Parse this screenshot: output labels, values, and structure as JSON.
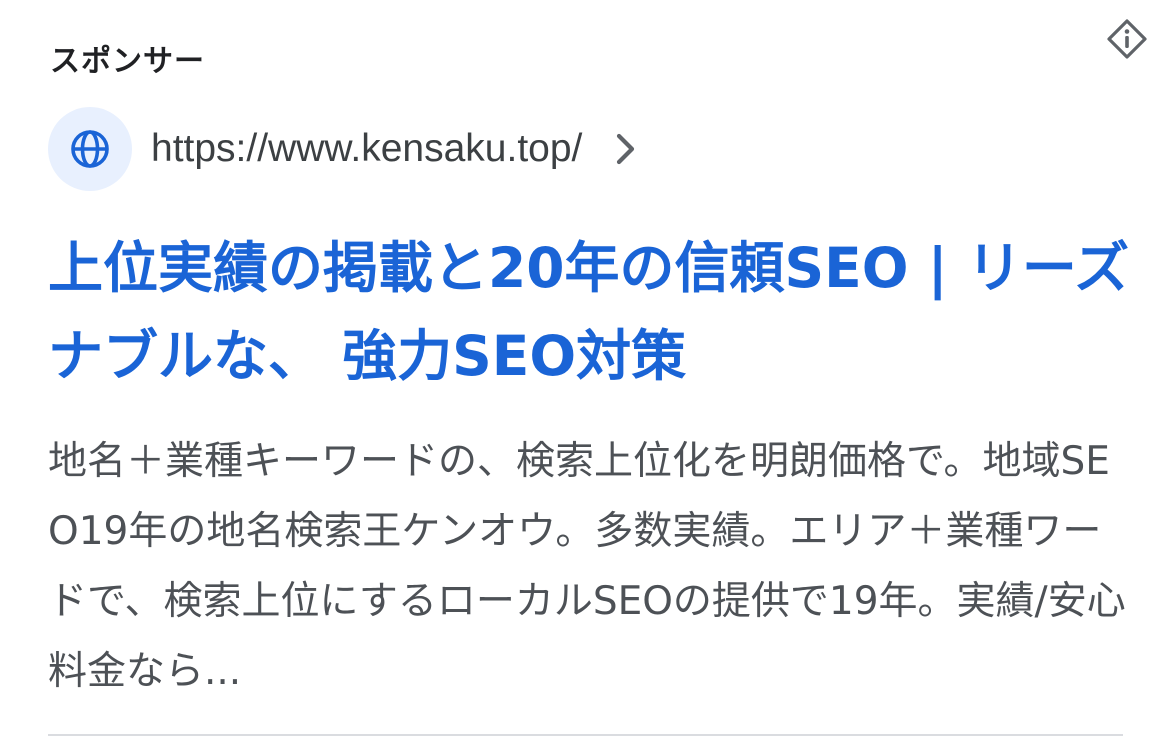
{
  "ad": {
    "sponsor_label": "スポンサー",
    "url": "https://www.kensaku.top/",
    "title": "上位実績の掲載と20年の信頼SEO | リーズナブルな、 強力SEO対策",
    "description": "地名＋業種キーワードの、検索上位化を明朗価格で。地域SEO19年の地名検索王ケンオウ。多数実績。エリア＋業種ワードで、検索上位にするローカルSEOの提供で19年。実績/安心料金なら..."
  },
  "icons": {
    "info": "info-diamond-icon",
    "favicon": "globe-icon",
    "chevron": "chevron-right-icon"
  },
  "colors": {
    "title": "#1a64d6",
    "favicon_bg": "#e8f0fe",
    "url_text": "#3c4043",
    "body_text": "#4d5156"
  }
}
